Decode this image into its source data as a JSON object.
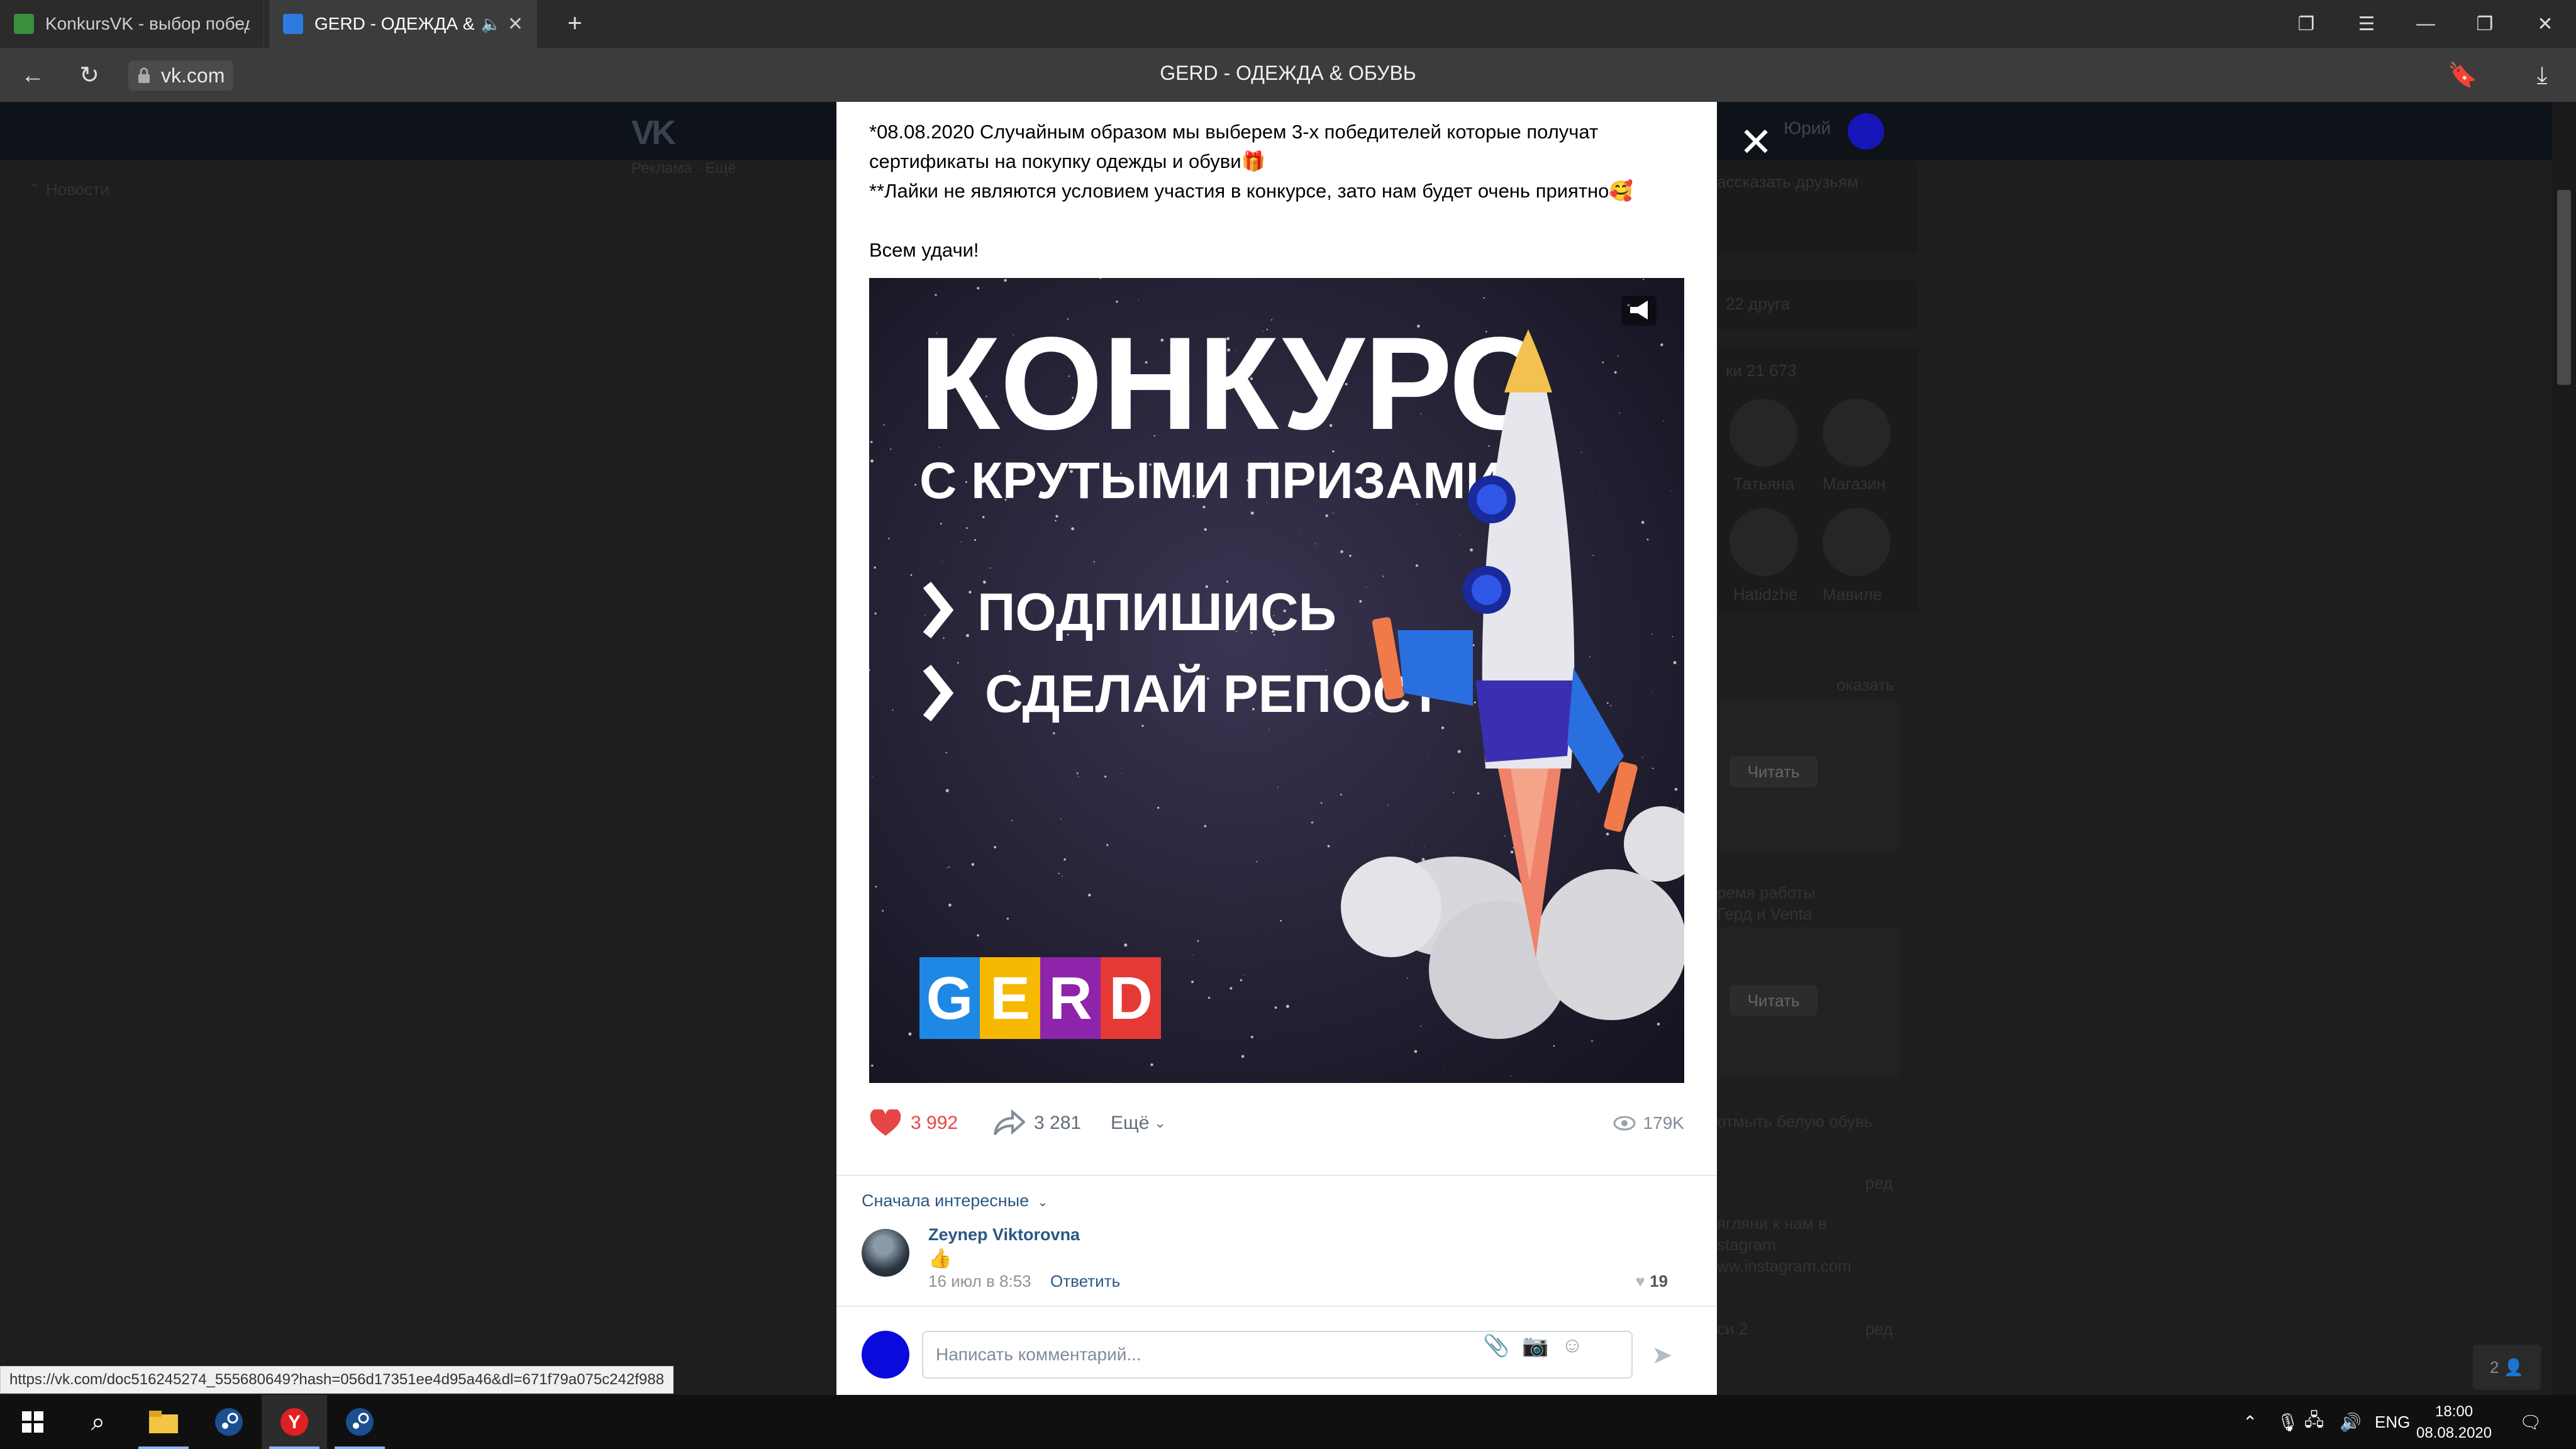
{
  "browser": {
    "tabs": [
      {
        "label": "KonkursVK - выбор побед",
        "favicon_color": "#4caf50"
      },
      {
        "label": "GERD - ОДЕЖДА &",
        "favicon_color": "#2d7be0",
        "audio": "speaker-icon"
      }
    ],
    "new_tab": "+",
    "url": "vk.com",
    "page_title": "GERD - ОДЕЖДА & ОБУВЬ",
    "status_url": "https://vk.com/doc516245274_555680649?hash=056d17351ee4d95a46&dl=671f79a075c242f988"
  },
  "vk_background": {
    "user_name": "Юрий",
    "news": "Новости",
    "ads": "Реклама · Ещё",
    "tell_friends": "ассказать друзьям",
    "friends_count": "22 друга",
    "followers": "ки 21 673",
    "contacts": [
      "Татьяна",
      "Магазин",
      "Hatidzhe",
      "Мавиле"
    ],
    "show": "оказать",
    "read": "Читать",
    "card1_caption": [
      "ремя работы",
      "Герд и Venta"
    ],
    "card2_caption": "отмыть белую обувь",
    "edit": "ред",
    "links": [
      "ягляни к нам в",
      "stagram",
      "ww.instagram.com"
    ],
    "section": "си 2",
    "friends_online": "2"
  },
  "post": {
    "text_lines": [
      "*08.08.2020 Случайным образом мы выберем 3-х победителей которые получат",
      "сертификаты на покупку одежды и обуви🎁",
      "**Лайки не являются условием участия в конкурсе, зато нам будет очень приятно🥰",
      "",
      "Всем удачи!"
    ],
    "image": {
      "title": "КОНКУРС",
      "subtitle": "С КРУТЫМИ ПРИЗАМИ",
      "step1": "ПОДПИШИСЬ",
      "step2": "СДЕЛАЙ РЕПОСТ",
      "logo_letters": [
        {
          "ch": "G",
          "color": "#1e88e5"
        },
        {
          "ch": "E",
          "color": "#f6b800"
        },
        {
          "ch": "R",
          "color": "#8e24aa"
        },
        {
          "ch": "D",
          "color": "#e53935"
        }
      ]
    },
    "likes": "3 992",
    "shares": "3 281",
    "more": "Ещё",
    "views": "179K"
  },
  "comments": {
    "sort_label": "Сначала интересные",
    "items": [
      {
        "author": "Zeynep Viktorovna",
        "text": "👍",
        "date": "16 июл в 8:53",
        "reply": "Ответить",
        "likes": "19"
      }
    ],
    "input_placeholder": "Написать комментарий..."
  },
  "taskbar": {
    "lang": "ENG",
    "time": "18:00",
    "date": "08.08.2020"
  }
}
